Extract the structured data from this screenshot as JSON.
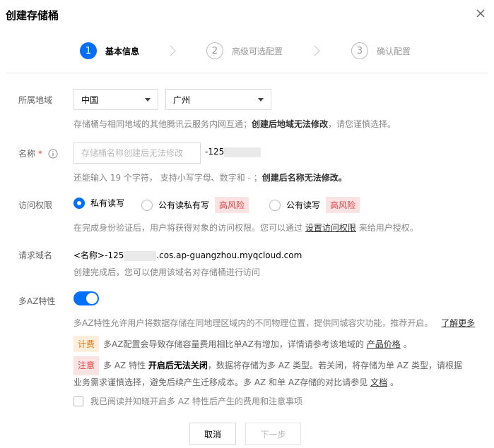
{
  "dialog": {
    "title": "创建存储桶"
  },
  "steps": [
    {
      "num": "1",
      "label": "基本信息"
    },
    {
      "num": "2",
      "label": "高级可选配置"
    },
    {
      "num": "3",
      "label": "确认配置"
    }
  ],
  "region": {
    "label": "所属地域",
    "country": "中国",
    "city": "广州",
    "help_prefix": "存储桶与相同地域的其他腾讯云服务内网互通；",
    "help_bold": "创建后地域无法修改",
    "help_suffix": "，请您谨慎选择。"
  },
  "name": {
    "label": "名称",
    "required_mark": "*",
    "placeholder": "存储桶名称创建后无法修改",
    "suffix": "-125",
    "help_prefix": "还能输入 19 个字符， 支持小写字母、数字和 - ；",
    "help_bold": "创建后名称无法修改。"
  },
  "access": {
    "label": "访问权限",
    "options": [
      {
        "label": "私有读写"
      },
      {
        "label": "公有读私有写",
        "badge": "高风险"
      },
      {
        "label": "公有读写",
        "badge": "高风险"
      }
    ],
    "help_prefix": "在完成身份验证后，用户将获得对象的访问权限。您可以通过",
    "help_link": "设置访问权限",
    "help_suffix": "来给用户授权。"
  },
  "domain": {
    "label": "请求域名",
    "prefix": "<名称>-125",
    "suffix": ".cos.ap-guangzhou.myqcloud.com",
    "help": "创建完成后，您可以使用该域名对存储桶进行访问"
  },
  "multi_az": {
    "label": "多AZ特性",
    "enabled": true,
    "desc": "多AZ特性允许用户将数据存储在同地理区域内的不同物理位置，提供同城容灾功能，推荐开启。",
    "learn_more": "了解更多",
    "fee_tag": "计费",
    "fee_text": "多AZ配置会导致存储容量费用相比单AZ有增加，详情请参考该地域的",
    "fee_link": "产品价格",
    "fee_end": "。",
    "note_tag": "注意",
    "note_prefix": "多 AZ 特性",
    "note_bold": "开启后无法关闭",
    "note_text1": "，数据将存储为多 AZ 类型。若关闭，将存储为单 AZ 类型，请根据",
    "note_text2": "业务需求谨慎选择，避免后续产生迁移成本。多 AZ 和单 AZ存储的对比请参见",
    "note_link": "文档",
    "note_end": "。",
    "ack_label": "我已阅读并知晓开启多 AZ 特性后产生的费用和注意事项"
  },
  "footer": {
    "cancel": "取消",
    "next": "下一步"
  },
  "colors": {
    "primary": "#006eff",
    "risk": "#e54545",
    "fee": "#e5781e"
  }
}
